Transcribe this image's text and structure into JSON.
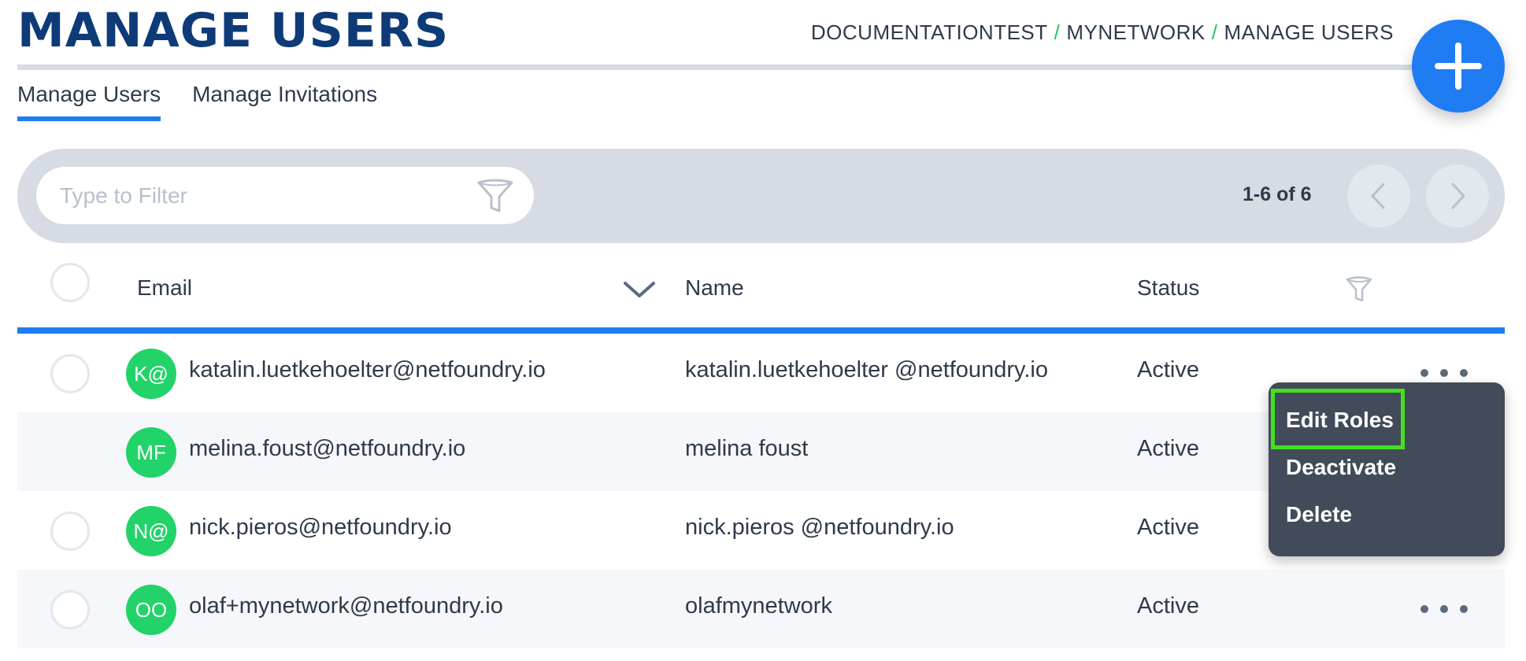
{
  "page": {
    "title": "MANAGE USERS",
    "breadcrumb": [
      "DOCUMENTATIONTEST",
      "MYNETWORK",
      "MANAGE USERS"
    ],
    "breadcrumb_separator": "/",
    "add_button_icon": "plus-icon"
  },
  "tabs": [
    {
      "label": "Manage Users",
      "active": true
    },
    {
      "label": "Manage Invitations",
      "active": false
    }
  ],
  "filter": {
    "placeholder": "Type to Filter",
    "value": "",
    "icon": "filter-icon",
    "page_count": "1-6 of 6"
  },
  "table": {
    "columns": {
      "email": "Email",
      "name": "Name",
      "status": "Status"
    },
    "rows": [
      {
        "initials": "K@",
        "email": "katalin.luetkehoelter@netfoundry.io",
        "name": "katalin.luetkehoelter @netfoundry.io",
        "status": "Active"
      },
      {
        "initials": "MF",
        "email": "melina.foust@netfoundry.io",
        "name": "melina foust",
        "status": "Active"
      },
      {
        "initials": "N@",
        "email": "nick.pieros@netfoundry.io",
        "name": "nick.pieros @netfoundry.io",
        "status": "Active"
      },
      {
        "initials": "OO",
        "email": "olaf+mynetwork@netfoundry.io",
        "name": "olafmynetwork",
        "status": "Active"
      }
    ]
  },
  "action_menu": {
    "items": [
      "Edit Roles",
      "Deactivate",
      "Delete"
    ],
    "highlighted_item": "Edit Roles",
    "highlight_color": "#44e020"
  },
  "colors": {
    "accent": "#1f7cf2",
    "title": "#0e3a78",
    "avatar": "#22d36a",
    "menu_bg": "#414b5a"
  }
}
